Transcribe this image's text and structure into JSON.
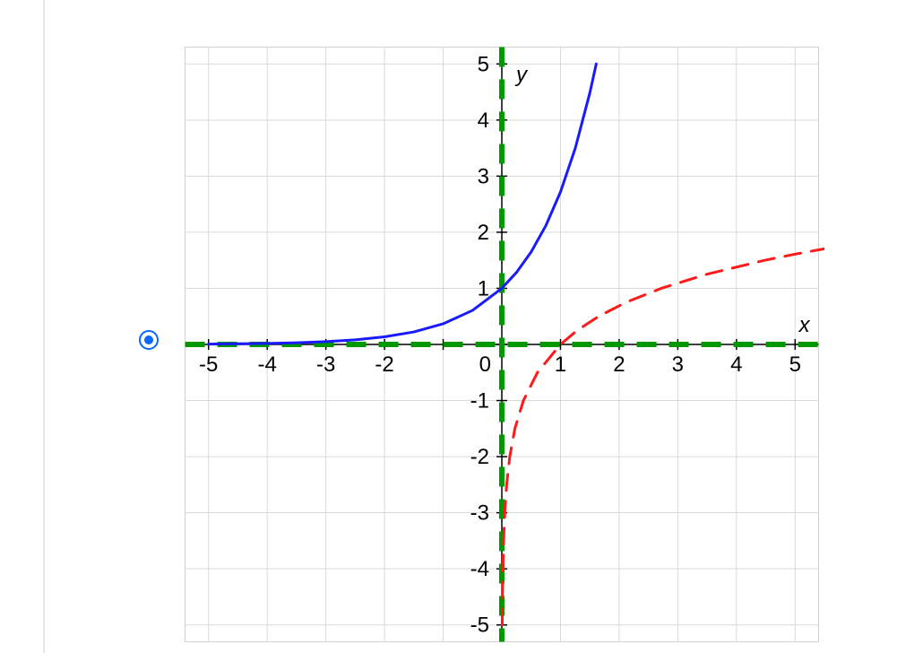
{
  "option": {
    "selected": true
  },
  "chart_data": {
    "type": "line",
    "title": "",
    "xlabel": "x",
    "ylabel": "y",
    "xlim": [
      -5.5,
      5.5
    ],
    "ylim": [
      -5.5,
      5.5
    ],
    "x_ticks": [
      -5,
      -4,
      -3,
      -2,
      -1,
      0,
      1,
      2,
      3,
      4,
      5
    ],
    "y_ticks": [
      -5,
      -4,
      -3,
      -2,
      -1,
      0,
      1,
      2,
      3,
      4,
      5
    ],
    "grid": true,
    "asymptotes": [
      {
        "axis": "x",
        "value": 0,
        "style": "dashed",
        "color": "#009900"
      },
      {
        "axis": "y",
        "value": 0,
        "style": "dashed",
        "color": "#009900"
      }
    ],
    "series": [
      {
        "name": "exp",
        "description": "y = e^x",
        "color": "#1a1aff",
        "style": "solid",
        "x": [
          -5.0,
          -4.5,
          -4.0,
          -3.5,
          -3.0,
          -2.5,
          -2.0,
          -1.5,
          -1.0,
          -0.5,
          0.0,
          0.25,
          0.5,
          0.75,
          1.0,
          1.25,
          1.5,
          1.6094
        ],
        "y": [
          0.0067,
          0.0111,
          0.0183,
          0.0302,
          0.0498,
          0.0821,
          0.1353,
          0.2231,
          0.3679,
          0.6065,
          1.0,
          1.284,
          1.6487,
          2.117,
          2.7183,
          3.4903,
          4.4817,
          5.0
        ]
      },
      {
        "name": "log",
        "description": "y = ln(x)",
        "color": "#ff1a1a",
        "style": "dashed",
        "x": [
          0.0067,
          0.0111,
          0.0183,
          0.0302,
          0.0498,
          0.0821,
          0.1353,
          0.2231,
          0.3679,
          0.6065,
          1.0,
          1.284,
          1.6487,
          2.117,
          2.7183,
          3.4903,
          4.4817,
          5.0,
          5.5
        ],
        "y": [
          -5.0,
          -4.5,
          -4.0,
          -3.5,
          -3.0,
          -2.5,
          -2.0,
          -1.5,
          -1.0,
          -0.5,
          0.0,
          0.25,
          0.5,
          0.75,
          1.0,
          1.25,
          1.5,
          1.6094,
          1.7047
        ]
      }
    ]
  },
  "labels": {
    "x_axis": "x",
    "y_axis": "y"
  }
}
